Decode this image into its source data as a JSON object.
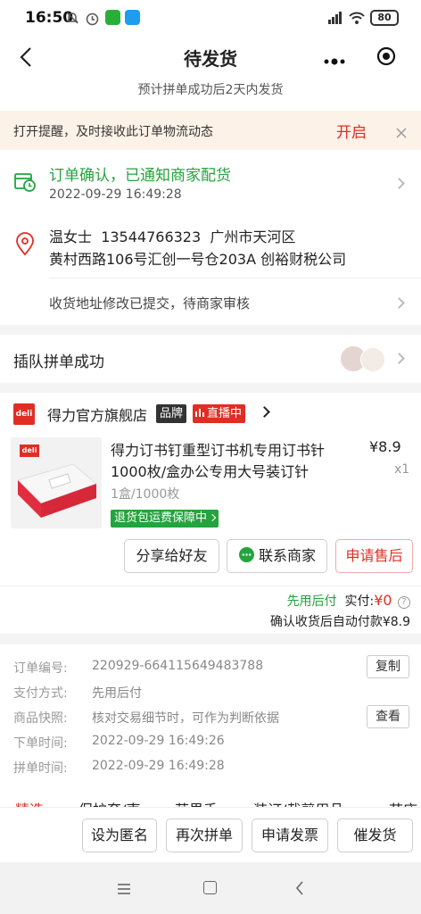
{
  "status_bar": {
    "time": "16:50",
    "battery": "80"
  },
  "nav": {
    "title": "待发货"
  },
  "subtitle": "预计拼单成功后2天内发货",
  "reminder": {
    "text": "打开提醒，及时接收此订单物流动态",
    "action": "开启"
  },
  "order_status": {
    "title": "订单确认，已通知商家配货",
    "time": "2022-09-29 16:49:28"
  },
  "address": {
    "name": "温女士",
    "phone": "13544766323",
    "region": "广州市天河区",
    "detail": "黄村西路106号汇创一号仓203A 创裕财税公司"
  },
  "address_notice": "收货地址修改已提交，待商家审核",
  "group": {
    "label": "插队拼单成功"
  },
  "store": {
    "logo": "deli",
    "name": "得力官方旗舰店",
    "brand_badge": "品牌",
    "live_badge": "直播中"
  },
  "product": {
    "title_line1": "得力订书钉重型订书机专用订书针",
    "title_line2": "1000枚/盒办公专用大号装订针",
    "price": "¥8.9",
    "qty": "x1",
    "spec": "1盒/1000枚",
    "guarantee": "退货包运费保障中",
    "box_brand": "deli"
  },
  "actions": {
    "share": "分享给好友",
    "contact": "联系商家",
    "after_sale": "申请售后"
  },
  "payment": {
    "method": "先用后付",
    "paid_label": "实付:",
    "paid_value": "¥0",
    "auto_pay": "确认收货后自动付款¥8.9"
  },
  "details": {
    "order_no_label": "订单编号:",
    "order_no": "220929-664115649483788",
    "copy": "复制",
    "pay_label": "支付方式:",
    "pay_value": "先用后付",
    "snapshot_label": "商品快照:",
    "snapshot_value": "核对交易细节时，可作为判断依据",
    "view": "查看",
    "order_time_label": "下单时间:",
    "order_time": "2022-09-29 16:49:26",
    "group_time_label": "拼单时间:",
    "group_time": "2022-09-29 16:49:28"
  },
  "category_tabs": [
    "精选",
    "保护套/壳",
    "苹果手",
    "装订/裁剪用品",
    "节庆"
  ],
  "bottom_buttons": {
    "anon": "设为匿名",
    "again": "再次拼单",
    "invoice": "申请发票",
    "urge": "催发货"
  },
  "colors": {
    "accent": "#e02e24",
    "green": "#25a33e",
    "reminder_bg": "#fdf2e8"
  }
}
